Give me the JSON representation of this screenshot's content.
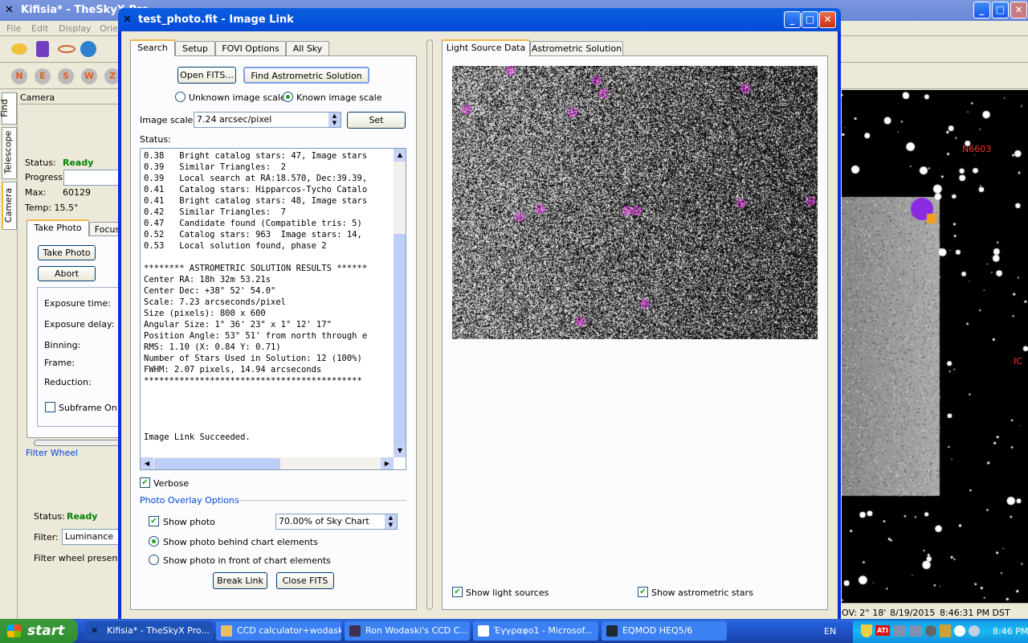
{
  "main_window": {
    "title": "Kifisia* - TheSkyX Pro",
    "menu": [
      "File",
      "Edit",
      "Display",
      "Orien"
    ],
    "side_tabs": [
      "Find",
      "Telescope",
      "Camera"
    ],
    "camera": {
      "header": "Camera",
      "status_label": "Status:",
      "status_value": "Ready",
      "progress_label": "Progress:",
      "max_label": "Max:",
      "max_value": "60129",
      "temp": "Temp: 15.5°",
      "tabs": [
        "Take Photo",
        "Focus"
      ],
      "take_photo_button": "Take Photo",
      "abort_button": "Abort",
      "fields": [
        "Exposure time:",
        "Exposure delay:",
        "Binning:",
        "Frame:",
        "Reduction:"
      ],
      "subframe": "Subframe On"
    },
    "filter_wheel": {
      "title": "Filter Wheel",
      "status_label": "Status:",
      "status_value": "Ready",
      "filter_label": "Filter:",
      "filter_value": "Luminance",
      "note": "Filter wheel presently"
    },
    "chart_labels": [
      "N6603",
      "IC"
    ],
    "statusbar": {
      "fov": "OV: 2° 18'",
      "date": "8/19/2015",
      "time": "8:46:31 PM DST"
    }
  },
  "dialog": {
    "title": "test_photo.fit - Image Link",
    "left_tabs": [
      "Search",
      "Setup",
      "FOVI Options",
      "All Sky"
    ],
    "open_fits": "Open FITS...",
    "find_solution": "Find Astrometric Solution",
    "unknown_scale": "Unknown image scale",
    "known_scale": "Known image scale",
    "scale_mode": "known",
    "image_scale_label": "Image scale:",
    "image_scale_value": "7.24 arcsec/pixel",
    "set_button": "Set",
    "status_label": "Status:",
    "log_lines": [
      "0.38   Bright catalog stars: 47, Image stars",
      "0.39   Similar Triangles:  2",
      "0.39   Local search at RA:18.570, Dec:39.39,",
      "0.41   Catalog stars: Hipparcos-Tycho Catalo",
      "0.41   Bright catalog stars: 48, Image stars",
      "0.42   Similar Triangles:  7",
      "0.47   Candidate found (Compatible tris: 5)",
      "0.52   Catalog stars: 963  Image stars: 14,",
      "0.53   Local solution found, phase 2",
      "",
      "******** ASTROMETRIC SOLUTION RESULTS ******",
      "Center RA: 18h 32m 53.21s",
      "Center Dec: +38° 52' 54.0\"",
      "Scale: 7.23 arcseconds/pixel",
      "Size (pixels): 800 x 600",
      "Angular Size: 1° 36' 23\" x 1° 12' 17\"",
      "Position Angle: 53° 51' from north through e",
      "RMS: 1.10 (X: 0.84 Y: 0.71)",
      "Number of Stars Used in Solution: 12 (100%)",
      "FWHM: 2.07 pixels, 14.94 arcseconds",
      "*******************************************",
      "",
      "",
      "",
      "",
      "Image Link Succeeded."
    ],
    "verbose": "Verbose",
    "verbose_checked": true,
    "overlay_title": "Photo Overlay Options",
    "show_photo": "Show photo",
    "show_photo_checked": true,
    "opacity_value": "70.00% of Sky Chart",
    "behind": "Show photo behind chart elements",
    "front": "Show photo in front of chart elements",
    "placement": "behind",
    "break_link": "Break Link",
    "close_fits": "Close FITS",
    "right_tabs": [
      "Light Source Data",
      "Astrometric Solution"
    ],
    "show_light_sources": "Show light sources",
    "show_astrometric_stars": "Show astrometric stars"
  },
  "taskbar": {
    "start": "start",
    "items": [
      "Kifisia* - TheSkyX Pro...",
      "CCD calculator+wodaski",
      "Ron Wodaski's CCD C...",
      "Έγγραφο1 - Microsof...",
      "EQMOD HEQ5/6"
    ],
    "lang": "EN",
    "clock": "8:46 PM"
  },
  "colors": {
    "ready": "#008000",
    "title_blue": "#0a246a",
    "xp_blue": "#245edb",
    "link_blue": "#0046d5",
    "marker": "#ff40ff"
  }
}
